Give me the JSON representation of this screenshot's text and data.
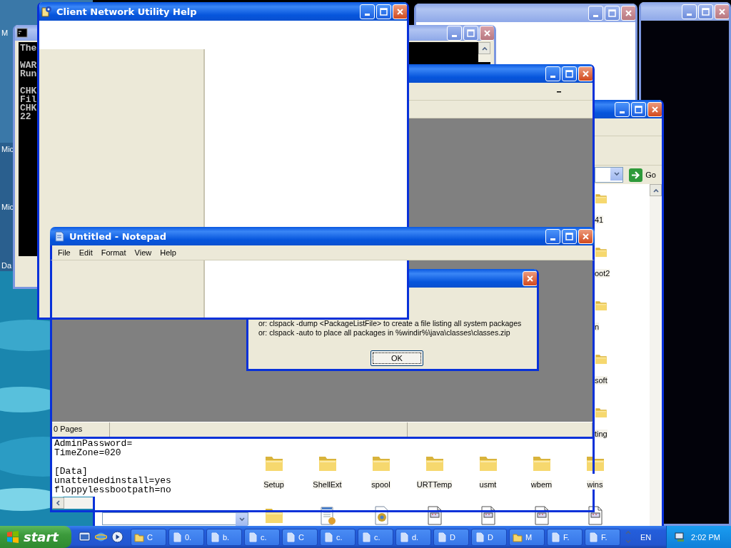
{
  "desktop_icons": [
    {
      "label": "M"
    },
    {
      "label": "Mic"
    },
    {
      "label": "Mic"
    },
    {
      "label": "Da"
    }
  ],
  "background_windows": [
    {
      "active": false
    },
    {
      "active": false
    }
  ],
  "console_window": {
    "active": false,
    "paragraphs": [
      [
        "The"
      ],
      [
        "WAR",
        "Run"
      ],
      [
        "CHK",
        "Fil",
        "CHK",
        "22"
      ]
    ]
  },
  "explorer_window": {
    "active": true,
    "go_button": "Go",
    "side_items": [
      "41",
      "oot2",
      "n",
      "soft",
      "ting"
    ],
    "items": [
      "Setup",
      "ShellExt",
      "spool",
      "URTTemp",
      "usmt",
      "wbem",
      "wins"
    ],
    "next_row": [
      {
        "kind": "folder"
      },
      {
        "kind": "notepad"
      },
      {
        "kind": "setup"
      },
      {
        "kind": "file"
      },
      {
        "kind": "file"
      },
      {
        "kind": "file"
      },
      {
        "kind": "file"
      }
    ]
  },
  "viewer_window": {
    "active": true,
    "status": "0 Pages"
  },
  "dialog": {
    "active": true,
    "lines": [
      "or: clspack -dump <PackageListFile> to create a file listing all system packages",
      "or: clspack -auto to place all packages in %windir%\\java\\classes\\classes.zip"
    ],
    "ok_button": "OK"
  },
  "help_window": {
    "active": true,
    "title": "Client Network Utility Help"
  },
  "notepad": {
    "active": true,
    "title": "Untitled - Notepad",
    "menu": [
      "File",
      "Edit",
      "Format",
      "View",
      "Help"
    ],
    "paragraphs": [
      [
        "AdminPassword=",
        "TimeZone=020"
      ],
      [
        "[Data]",
        "unattendedinstall=yes",
        "floppylessbootpath=no"
      ]
    ]
  },
  "taskbar": {
    "start": "start",
    "tasks": [
      {
        "kind": "folder",
        "label": "C"
      },
      {
        "kind": "document",
        "label": "0."
      },
      {
        "kind": "document",
        "label": "b."
      },
      {
        "kind": "document",
        "label": "c."
      },
      {
        "kind": "document",
        "label": "C"
      },
      {
        "kind": "document",
        "label": "c."
      },
      {
        "kind": "document",
        "label": "c."
      },
      {
        "kind": "document",
        "label": "d."
      },
      {
        "kind": "document",
        "label": "D"
      },
      {
        "kind": "document",
        "label": "D"
      },
      {
        "kind": "folder",
        "label": "M"
      },
      {
        "kind": "document",
        "label": "F."
      },
      {
        "kind": "document",
        "label": "F."
      }
    ],
    "language": "EN",
    "clock": "2:02 PM"
  }
}
